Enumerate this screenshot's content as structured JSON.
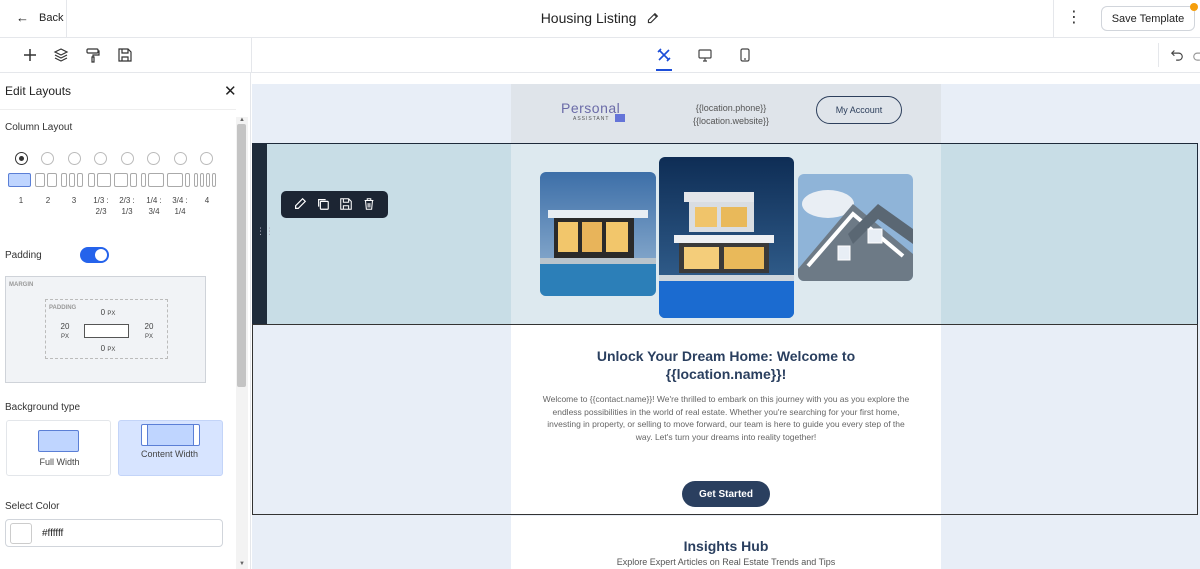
{
  "topbar": {
    "back_label": "Back",
    "title": "Housing Listing",
    "save_template_label": "Save Template",
    "notification_color": "#f59e0b"
  },
  "toolbar": {
    "left_icons": [
      "plus-icon",
      "layers-icon",
      "paint-roller-icon",
      "save-icon"
    ],
    "device_icons": [
      "tools-icon",
      "desktop-icon",
      "mobile-icon"
    ],
    "active_device": "tools-icon",
    "right_icons": [
      "undo-icon",
      "redo-icon"
    ]
  },
  "panel": {
    "title": "Edit Layouts",
    "column_layout_label": "Column Layout",
    "column_options": [
      {
        "label": "1",
        "selected": true
      },
      {
        "label": "2",
        "selected": false
      },
      {
        "label": "3",
        "selected": false
      },
      {
        "label": "1/3 : 2/3",
        "selected": false
      },
      {
        "label": "2/3 : 1/3",
        "selected": false
      },
      {
        "label": "1/4 : 3/4",
        "selected": false
      },
      {
        "label": "3/4 : 1/4",
        "selected": false
      },
      {
        "label": "4",
        "selected": false
      }
    ],
    "padding_label": "Padding",
    "padding_enabled": true,
    "margin_label": "MARGIN",
    "padding_box_label": "PADDING",
    "padding_top": "0",
    "padding_bottom": "0",
    "padding_left": "20",
    "padding_right": "20",
    "unit": "PX",
    "background_type_label": "Background type",
    "background_options": [
      {
        "label": "Full Width",
        "selected": false
      },
      {
        "label": "Content Width",
        "selected": true
      }
    ],
    "select_color_label": "Select Color",
    "color_value": "#ffffff",
    "accent_color": "#2563eb"
  },
  "email": {
    "logo_text": "Personal",
    "logo_subtext": "ASSISTANT",
    "location_phone": "{{location.phone}}",
    "location_website": "{{location.website}}",
    "account_button": "My Account",
    "headline": "Unlock Your Dream Home: Welcome to {{location.name}}!",
    "body": "Welcome to {{contact.name}}! We're thrilled to embark on this journey with you as you explore the endless possibilities in the world of real estate. Whether you're searching for your first home, investing in property, or selling to move forward, our team is here to guide you every step of the way. Let's turn your dreams into reality together!",
    "cta_label": "Get Started",
    "insights_title": "Insights Hub",
    "insights_subtitle": "Explore Expert Articles on Real Estate Trends and Tips",
    "brand_color": "#2a3f5f"
  }
}
